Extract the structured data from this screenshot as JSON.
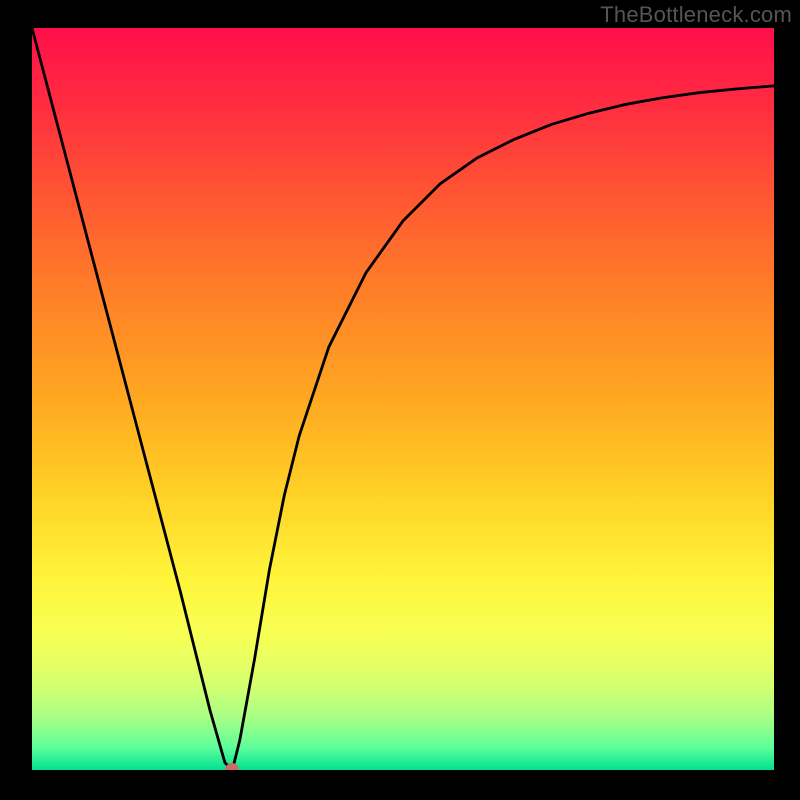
{
  "watermark": "TheBottleneck.com",
  "chart_data": {
    "type": "line",
    "title": "",
    "xlabel": "",
    "ylabel": "",
    "xlim": [
      0,
      100
    ],
    "ylim": [
      0,
      100
    ],
    "series": [
      {
        "name": "curve",
        "x": [
          0,
          5,
          10,
          15,
          20,
          24,
          26,
          27,
          28,
          30,
          32,
          34,
          36,
          40,
          45,
          50,
          55,
          60,
          65,
          70,
          75,
          80,
          85,
          90,
          95,
          100
        ],
        "values": [
          100,
          81,
          62,
          43,
          24,
          8,
          1,
          0,
          4,
          15,
          27,
          37,
          45,
          57,
          67,
          74,
          79,
          82.5,
          85,
          87,
          88.5,
          89.7,
          90.6,
          91.3,
          91.8,
          92.2
        ]
      }
    ],
    "marker": {
      "x": 27,
      "y": 0
    },
    "background_gradient": {
      "stops": [
        {
          "pos": 0.0,
          "color": "#ff0f4a"
        },
        {
          "pos": 0.1,
          "color": "#ff2b41"
        },
        {
          "pos": 0.22,
          "color": "#ff5433"
        },
        {
          "pos": 0.35,
          "color": "#ff7d28"
        },
        {
          "pos": 0.5,
          "color": "#ffa821"
        },
        {
          "pos": 0.62,
          "color": "#ffcf25"
        },
        {
          "pos": 0.74,
          "color": "#fff43a"
        },
        {
          "pos": 0.82,
          "color": "#f7ff55"
        },
        {
          "pos": 0.88,
          "color": "#d9ff6d"
        },
        {
          "pos": 0.93,
          "color": "#a7ff85"
        },
        {
          "pos": 0.97,
          "color": "#5dff9b"
        },
        {
          "pos": 1.0,
          "color": "#00e08f"
        }
      ]
    }
  }
}
